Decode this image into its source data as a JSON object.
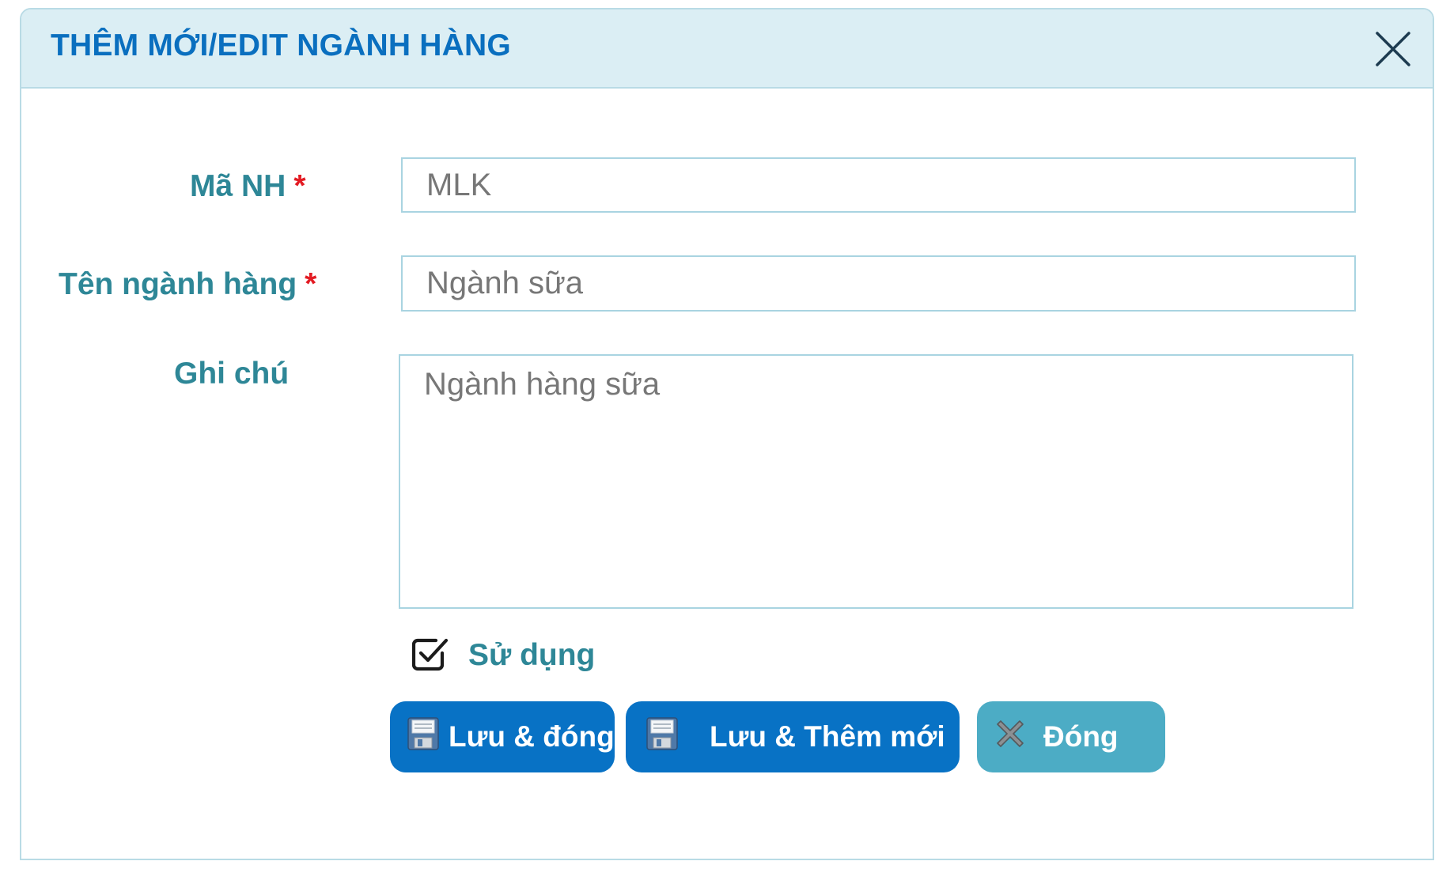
{
  "dialog": {
    "title": "THÊM MỚI/EDIT NGÀNH HÀNG",
    "close_icon": "close-icon"
  },
  "form": {
    "ma_nh": {
      "label": "Mã NH",
      "required_mark": "*",
      "value": "MLK"
    },
    "ten_nganh_hang": {
      "label": "Tên ngành hàng",
      "required_mark": "*",
      "value": "Ngành sữa"
    },
    "ghi_chu": {
      "label": "Ghi chú",
      "value": "Ngành hàng sữa"
    },
    "su_dung": {
      "label": "Sử dụng",
      "checked": true
    }
  },
  "actions": {
    "save_close_label": "Lưu & đóng",
    "save_new_label": "Lưu & Thêm mới",
    "close_label": "Đóng",
    "save_icon": "floppy-disk-icon",
    "close_icon": "x-icon"
  },
  "colors": {
    "header_bg": "#dbeef4",
    "title": "#0a6fbf",
    "label": "#2e8797",
    "required": "#e31b23",
    "primary_button": "#0872c5",
    "secondary_button": "#4cacc5",
    "input_border": "#a9d4e1"
  }
}
